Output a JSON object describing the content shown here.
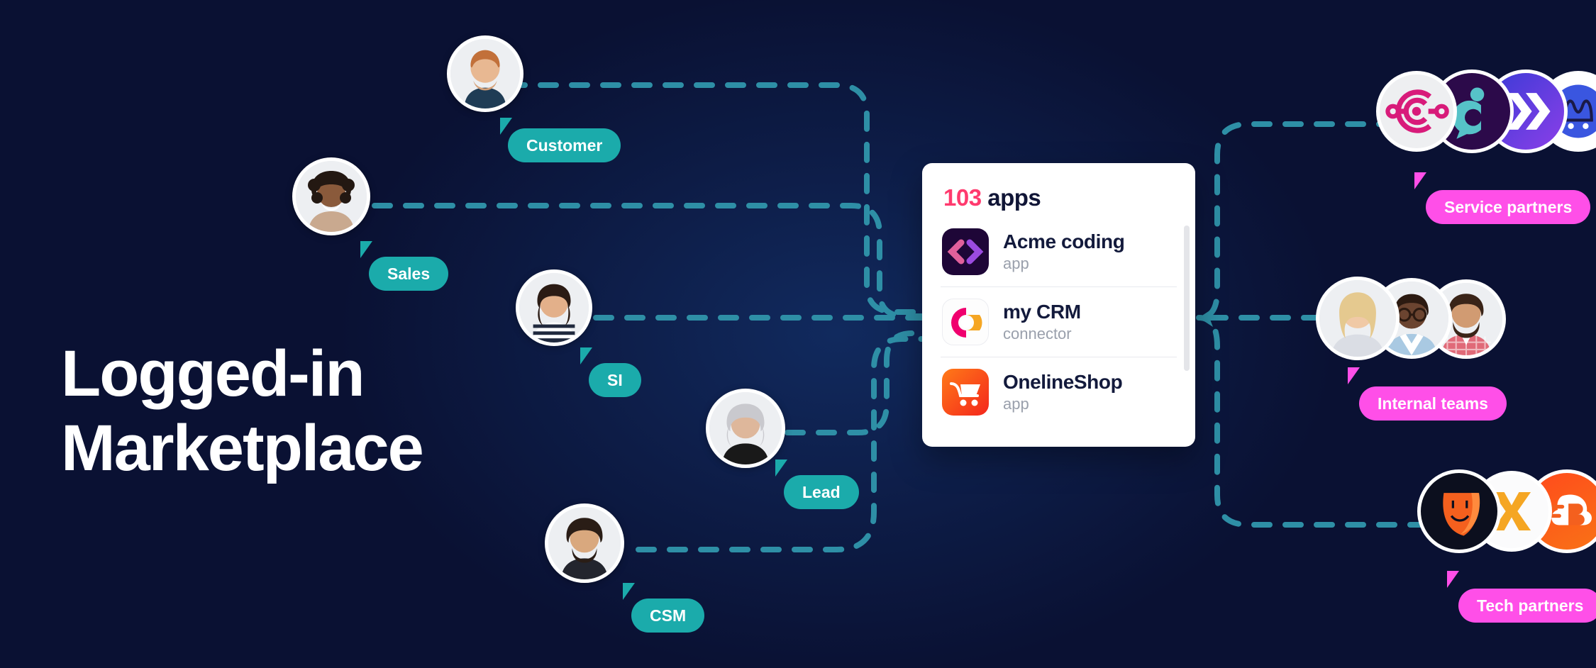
{
  "headline": {
    "text": "Logged-in\nMarketplace"
  },
  "colors": {
    "background_navy": "#0A1133",
    "background_mid": "#112A5E",
    "teal": "#1BABAB",
    "wire_teal": "#2E8FA6",
    "pink": "#FF4FE8",
    "count_pink": "#FF3A6E",
    "card_white": "#FFFFFF",
    "app_name": "#131A3C",
    "app_kind": "#9AA0AC"
  },
  "card": {
    "count": "103",
    "count_label": "apps",
    "apps": [
      {
        "name": "Acme coding",
        "kind": "app",
        "icon": "acme-coding-icon"
      },
      {
        "name": "my CRM",
        "kind": "connector",
        "icon": "my-crm-icon"
      },
      {
        "name": "OnelineShop",
        "kind": "app",
        "icon": "onelineshop-icon"
      }
    ]
  },
  "personas": [
    {
      "id": "customer",
      "label": "Customer",
      "color": "teal"
    },
    {
      "id": "sales",
      "label": "Sales",
      "color": "teal"
    },
    {
      "id": "si",
      "label": "SI",
      "color": "teal"
    },
    {
      "id": "lead",
      "label": "Lead",
      "color": "teal"
    },
    {
      "id": "csm",
      "label": "CSM",
      "color": "teal"
    }
  ],
  "partners": [
    {
      "id": "service-partners",
      "label": "Service partners",
      "color": "pink"
    },
    {
      "id": "internal-teams",
      "label": "Internal teams",
      "color": "pink"
    },
    {
      "id": "tech-partners",
      "label": "Tech partners",
      "color": "pink"
    }
  ]
}
